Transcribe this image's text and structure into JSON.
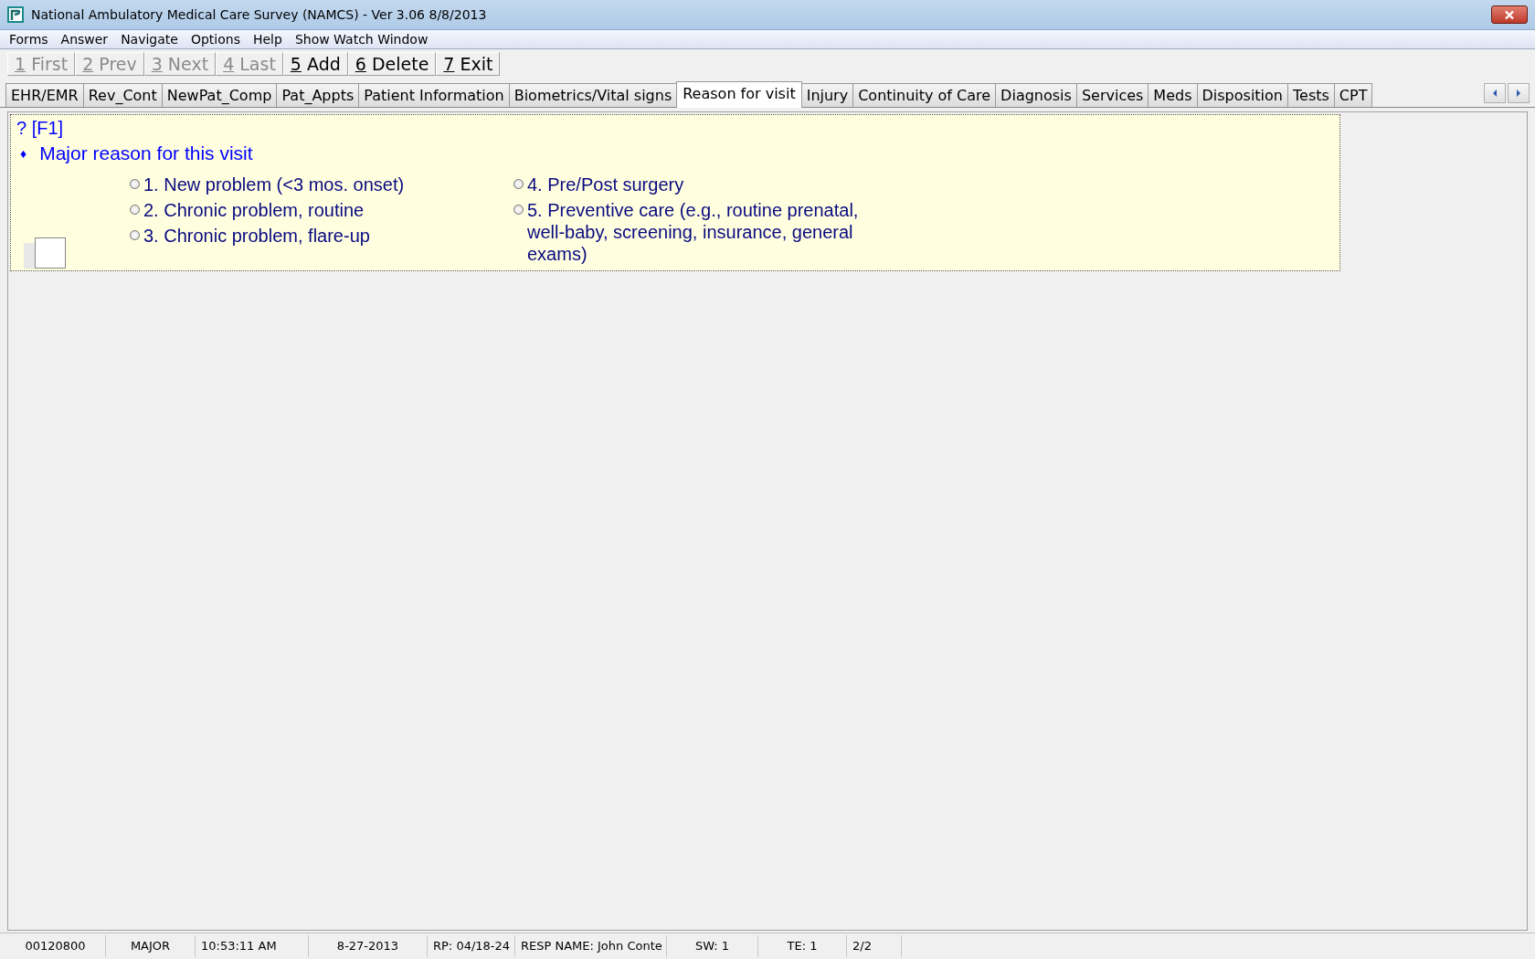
{
  "window": {
    "title": "National Ambulatory Medical Care Survey (NAMCS) - Ver 3.06 8/8/2013"
  },
  "menu": [
    "Forms",
    "Answer",
    "Navigate",
    "Options",
    "Help",
    "Show Watch Window"
  ],
  "toolbar": [
    {
      "key": "1",
      "label": "First",
      "disabled": true
    },
    {
      "key": "2",
      "label": "Prev",
      "disabled": true
    },
    {
      "key": "3",
      "label": "Next",
      "disabled": true
    },
    {
      "key": "4",
      "label": "Last",
      "disabled": true
    },
    {
      "key": "5",
      "label": "Add",
      "disabled": false
    },
    {
      "key": "6",
      "label": "Delete",
      "disabled": false
    },
    {
      "key": "7",
      "label": "Exit",
      "disabled": false
    }
  ],
  "tabs": [
    {
      "label": "EHR/EMR",
      "selected": false
    },
    {
      "label": "Rev_Cont",
      "selected": false
    },
    {
      "label": "NewPat_Comp",
      "selected": false
    },
    {
      "label": "Pat_Appts",
      "selected": false
    },
    {
      "label": "Patient Information",
      "selected": false
    },
    {
      "label": "Biometrics/Vital signs",
      "selected": false
    },
    {
      "label": "Reason for visit",
      "selected": true
    },
    {
      "label": "Injury",
      "selected": false
    },
    {
      "label": "Continuity of Care",
      "selected": false
    },
    {
      "label": "Diagnosis",
      "selected": false
    },
    {
      "label": "Services",
      "selected": false
    },
    {
      "label": "Meds",
      "selected": false
    },
    {
      "label": "Disposition",
      "selected": false
    },
    {
      "label": "Tests",
      "selected": false
    },
    {
      "label": "CPT",
      "selected": false
    }
  ],
  "question": {
    "help": "? [F1]",
    "bullet": "♦",
    "text": "Major reason for this visit",
    "options_left": [
      {
        "label": "1. New problem (<3 mos. onset)",
        "selected": false
      },
      {
        "label": "2. Chronic problem, routine",
        "selected": false
      },
      {
        "label": "3. Chronic problem, flare-up",
        "selected": false
      }
    ],
    "options_right": [
      {
        "label": "4. Pre/Post surgery",
        "selected": false
      },
      {
        "label": "5. Preventive care (e.g., routine prenatal, well-baby, screening, insurance, general exams)",
        "selected": false
      }
    ]
  },
  "status_bar": [
    "00120800",
    "MAJOR",
    "10:53:11 AM",
    "8-27-2013",
    "RP: 04/18-24",
    "RESP NAME: John  Conte",
    "SW: 1",
    "TE: 1",
    "2/2"
  ]
}
